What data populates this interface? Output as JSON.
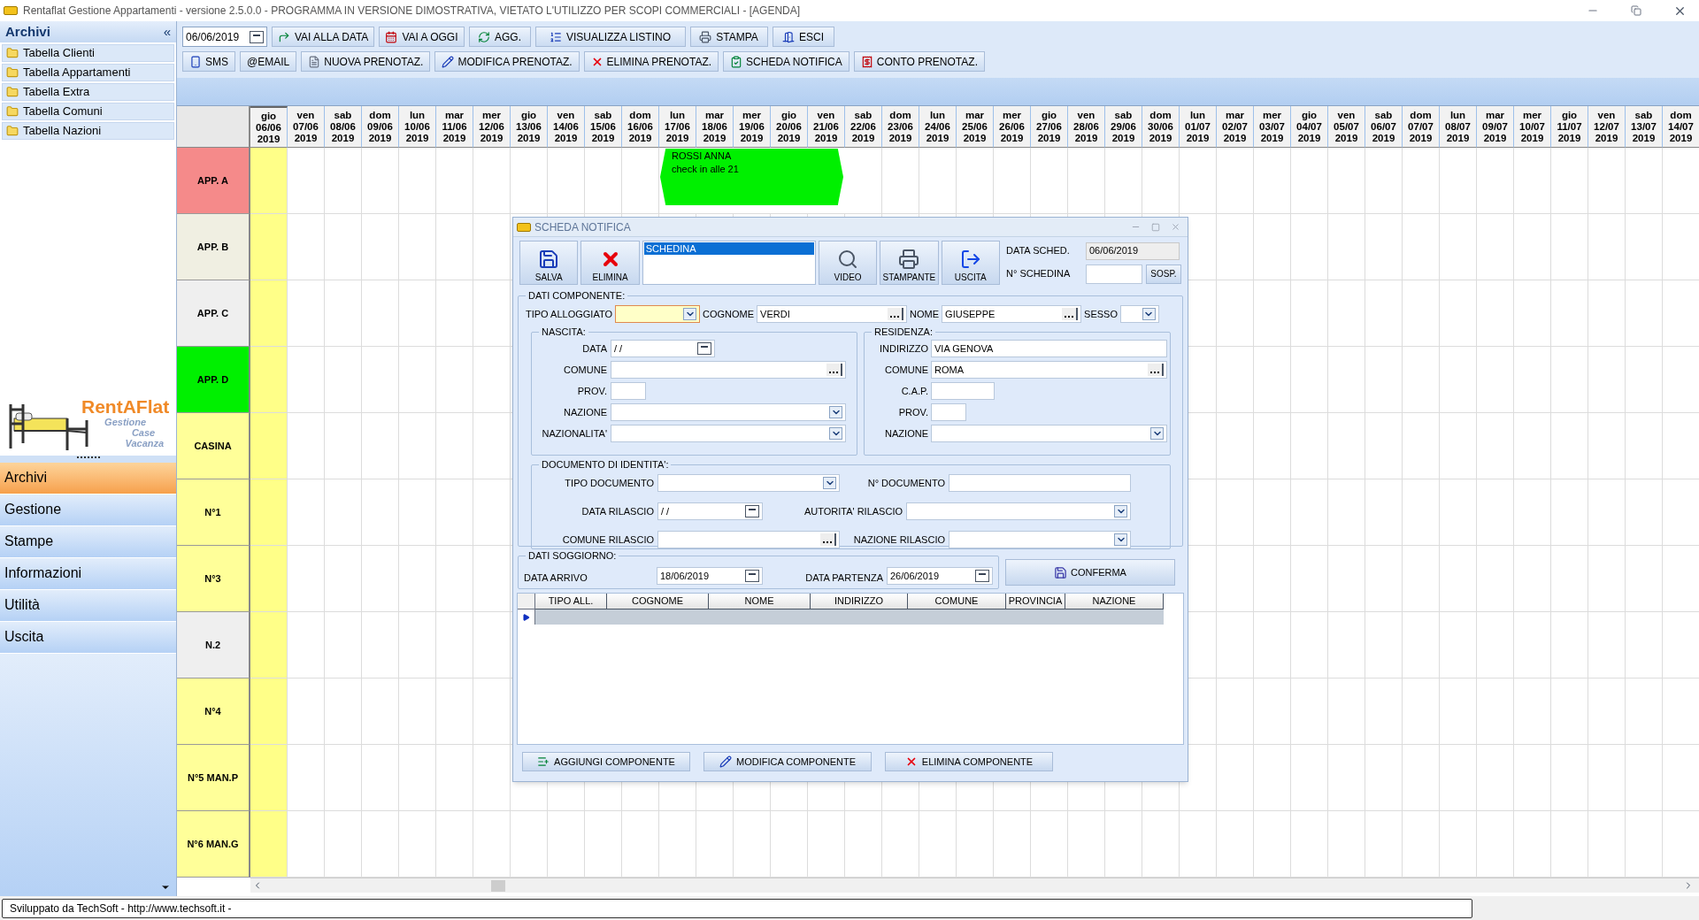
{
  "window": {
    "title": "Rentaflat Gestione Appartamenti - versione 2.5.0.0 - PROGRAMMA IN VERSIONE DIMOSTRATIVA, VIETATO L'UTILIZZO PER SCOPI COMMERCIALI - [AGENDA]"
  },
  "sidebar": {
    "header": "Archivi",
    "collapse": "«",
    "items": [
      {
        "label": "Tabella Clienti"
      },
      {
        "label": "Tabella Appartamenti"
      },
      {
        "label": "Tabella Extra"
      },
      {
        "label": "Tabella Comuni"
      },
      {
        "label": "Tabella Nazioni"
      }
    ],
    "logo": {
      "name": "RentAFlat",
      "tagline": [
        "Gestione",
        "Case",
        "Vacanza"
      ]
    },
    "nav": [
      {
        "label": "Archivi",
        "selected": true
      },
      {
        "label": "Gestione",
        "selected": false
      },
      {
        "label": "Stampe",
        "selected": false
      },
      {
        "label": "Informazioni",
        "selected": false
      },
      {
        "label": "Utilità",
        "selected": false
      },
      {
        "label": "Uscita",
        "selected": false
      }
    ]
  },
  "toolbar": {
    "date": "06/06/2019",
    "row1": [
      {
        "label": "VAI ALLA DATA",
        "kind": "goto"
      },
      {
        "label": "VAI A OGGI",
        "kind": "today"
      },
      {
        "label": "AGG.",
        "kind": "refresh"
      },
      {
        "label": "VISUALIZZA LISTINO",
        "kind": "list"
      },
      {
        "label": "STAMPA",
        "kind": "print"
      },
      {
        "label": "ESCI",
        "kind": "exit"
      }
    ],
    "row2": [
      {
        "label": "SMS",
        "kind": "sms"
      },
      {
        "label": "@EMAIL",
        "kind": "none"
      },
      {
        "label": "NUOVA PRENOTAZ.",
        "kind": "new"
      },
      {
        "label": "MODIFICA PRENOTAZ.",
        "kind": "edit"
      },
      {
        "label": "ELIMINA PRENOTAZ.",
        "kind": "delete"
      },
      {
        "label": "SCHEDA NOTIFICA",
        "kind": "form"
      },
      {
        "label": "CONTO PRENOTAZ.",
        "kind": "bill"
      }
    ]
  },
  "calendar": {
    "columns": [
      {
        "day": "gio",
        "date": "06/06",
        "year": "2019",
        "selected": true
      },
      {
        "day": "ven",
        "date": "07/06",
        "year": "2019",
        "selected": false
      },
      {
        "day": "sab",
        "date": "08/06",
        "year": "2019",
        "selected": false
      },
      {
        "day": "dom",
        "date": "09/06",
        "year": "2019",
        "selected": false
      },
      {
        "day": "lun",
        "date": "10/06",
        "year": "2019",
        "selected": false
      },
      {
        "day": "mar",
        "date": "11/06",
        "year": "2019",
        "selected": false
      },
      {
        "day": "mer",
        "date": "12/06",
        "year": "2019",
        "selected": false
      },
      {
        "day": "gio",
        "date": "13/06",
        "year": "2019",
        "selected": false
      },
      {
        "day": "ven",
        "date": "14/06",
        "year": "2019",
        "selected": false
      },
      {
        "day": "sab",
        "date": "15/06",
        "year": "2019",
        "selected": false
      },
      {
        "day": "dom",
        "date": "16/06",
        "year": "2019",
        "selected": false
      },
      {
        "day": "lun",
        "date": "17/06",
        "year": "2019",
        "selected": false
      },
      {
        "day": "mar",
        "date": "18/06",
        "year": "2019",
        "selected": false
      },
      {
        "day": "mer",
        "date": "19/06",
        "year": "2019",
        "selected": false
      },
      {
        "day": "gio",
        "date": "20/06",
        "year": "2019",
        "selected": false
      },
      {
        "day": "ven",
        "date": "21/06",
        "year": "2019",
        "selected": false
      },
      {
        "day": "sab",
        "date": "22/06",
        "year": "2019",
        "selected": false
      },
      {
        "day": "dom",
        "date": "23/06",
        "year": "2019",
        "selected": false
      },
      {
        "day": "lun",
        "date": "24/06",
        "year": "2019",
        "selected": false
      },
      {
        "day": "mar",
        "date": "25/06",
        "year": "2019",
        "selected": false
      },
      {
        "day": "mer",
        "date": "26/06",
        "year": "2019",
        "selected": false
      },
      {
        "day": "gio",
        "date": "27/06",
        "year": "2019",
        "selected": false
      },
      {
        "day": "ven",
        "date": "28/06",
        "year": "2019",
        "selected": false
      },
      {
        "day": "sab",
        "date": "29/06",
        "year": "2019",
        "selected": false
      },
      {
        "day": "dom",
        "date": "30/06",
        "year": "2019",
        "selected": false
      },
      {
        "day": "lun",
        "date": "01/07",
        "year": "2019",
        "selected": false
      },
      {
        "day": "mar",
        "date": "02/07",
        "year": "2019",
        "selected": false
      },
      {
        "day": "mer",
        "date": "03/07",
        "year": "2019",
        "selected": false
      },
      {
        "day": "gio",
        "date": "04/07",
        "year": "2019",
        "selected": false
      },
      {
        "day": "ven",
        "date": "05/07",
        "year": "2019",
        "selected": false
      },
      {
        "day": "sab",
        "date": "06/07",
        "year": "2019",
        "selected": false
      },
      {
        "day": "dom",
        "date": "07/07",
        "year": "2019",
        "selected": false
      },
      {
        "day": "lun",
        "date": "08/07",
        "year": "2019",
        "selected": false
      },
      {
        "day": "mar",
        "date": "09/07",
        "year": "2019",
        "selected": false
      },
      {
        "day": "mer",
        "date": "10/07",
        "year": "2019",
        "selected": false
      },
      {
        "day": "gio",
        "date": "11/07",
        "year": "2019",
        "selected": false
      },
      {
        "day": "ven",
        "date": "12/07",
        "year": "2019",
        "selected": false
      },
      {
        "day": "sab",
        "date": "13/07",
        "year": "2019",
        "selected": false
      },
      {
        "day": "dom",
        "date": "14/07",
        "year": "2019",
        "selected": false
      }
    ],
    "rows": [
      {
        "label": "APP. A",
        "color": "#f58a8a",
        "bookings": [
          {
            "guest": "ROSSI ANNA",
            "note": "check in alle 21",
            "color": "#00f000"
          }
        ]
      },
      {
        "label": "APP. B",
        "color": "#f0efe2",
        "bookings": []
      },
      {
        "label": "APP. C",
        "color": "#efefef",
        "bookings": []
      },
      {
        "label": "APP. D",
        "color": "#00f000",
        "bookings": []
      },
      {
        "label": "CASINA",
        "color": "#ffff99",
        "bookings": []
      },
      {
        "label": "N°1",
        "color": "#ffff99",
        "bookings": []
      },
      {
        "label": "N°3",
        "color": "#ffff99",
        "bookings": []
      },
      {
        "label": "N.2",
        "color": "#efefef",
        "bookings": []
      },
      {
        "label": "N°4",
        "color": "#ffff99",
        "bookings": []
      },
      {
        "label": "N°5 MAN.P",
        "color": "#ffff99",
        "bookings": []
      },
      {
        "label": "N°6 MAN.G",
        "color": "#ffff99",
        "bookings": []
      }
    ]
  },
  "dialog": {
    "title": "SCHEDA NOTIFICA",
    "tools_left": [
      {
        "label": "SALVA",
        "kind": "save"
      },
      {
        "label": "ELIMINA",
        "kind": "delete"
      }
    ],
    "list": [
      {
        "label": "SCHEDINA",
        "selected": true
      }
    ],
    "tools_right": [
      {
        "label": "VIDEO",
        "kind": "video"
      },
      {
        "label": "STAMPANTE",
        "kind": "printer"
      },
      {
        "label": "USCITA",
        "kind": "exit"
      }
    ],
    "data_sched": {
      "label": "DATA SCHED.",
      "value": "06/06/2019"
    },
    "n_schedina": {
      "label": "N° SCHEDINA"
    },
    "suspend": "SOSP.",
    "componente": {
      "title": "DATI COMPONENTE:",
      "top": [
        {
          "label": "TIPO ALLOGGIATO",
          "kind": "combo",
          "focused": true
        },
        {
          "label": "COGNOME",
          "value": "VERDI",
          "kind": "lookup",
          "focused": false
        },
        {
          "label": "NOME",
          "value": "GIUSEPPE",
          "kind": "lookup",
          "focused": false
        },
        {
          "label": "SESSO",
          "kind": "combo",
          "focused": false
        }
      ],
      "nascita": {
        "title": "NASCITA:",
        "fields": [
          {
            "label": "DATA",
            "value": "/ /",
            "kind": "date"
          },
          {
            "label": "COMUNE",
            "kind": "lookup"
          },
          {
            "label": "PROV.",
            "kind": "short"
          },
          {
            "label": "NAZIONE",
            "kind": "combo"
          },
          {
            "label": "NAZIONALITA'",
            "kind": "combo"
          }
        ]
      },
      "residenza": {
        "title": "RESIDENZA:",
        "fields": [
          {
            "label": "INDIRIZZO",
            "value": "VIA GENOVA",
            "kind": "text"
          },
          {
            "label": "COMUNE",
            "value": "ROMA",
            "kind": "lookup"
          },
          {
            "label": "C.A.P.",
            "kind": "medium"
          },
          {
            "label": "PROV.",
            "kind": "short"
          },
          {
            "label": "NAZIONE",
            "kind": "combo"
          }
        ]
      },
      "documento": {
        "title": "DOCUMENTO DI IDENTITA':",
        "rows": [
          [
            {
              "label": "TIPO DOCUMENTO",
              "kind": "combo"
            },
            {
              "label": "N° DOCUMENTO",
              "kind": "text"
            }
          ],
          [
            {
              "label": "DATA RILASCIO",
              "value": "/ /",
              "kind": "date"
            },
            {
              "label": "AUTORITA' RILASCIO",
              "kind": "combo"
            }
          ],
          [
            {
              "label": "COMUNE RILASCIO",
              "kind": "lookup"
            },
            {
              "label": "NAZIONE RILASCIO",
              "kind": "combo"
            }
          ]
        ]
      }
    },
    "soggiorno": {
      "title": "DATI SOGGIORNO:",
      "fields": [
        {
          "label": "DATA ARRIVO",
          "value": "18/06/2019",
          "kind": "date"
        },
        {
          "label": "DATA PARTENZA",
          "value": "26/06/2019",
          "kind": "date"
        }
      ],
      "confirm": "CONFERMA"
    },
    "table": {
      "columns": [
        "TIPO ALL.",
        "COGNOME",
        "NOME",
        "INDIRIZZO",
        "COMUNE",
        "PROVINCIA",
        "NAZIONE"
      ],
      "rows": [
        {
          "selected": true
        }
      ]
    },
    "buttons": [
      {
        "label": "AGGIUNGI COMPONENTE",
        "kind": "add"
      },
      {
        "label": "MODIFICA COMPONENTE",
        "kind": "edit"
      },
      {
        "label": "ELIMINA COMPONENTE",
        "kind": "delete"
      }
    ]
  },
  "status_bar": "Sviluppato da TechSoft - http://www.techsoft.it -"
}
